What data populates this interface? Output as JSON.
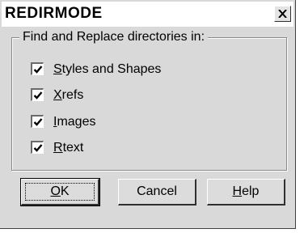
{
  "dialog": {
    "title": "REDIRMODE",
    "close_label": "close"
  },
  "group": {
    "legend": "Find and Replace directories in:"
  },
  "options": [
    {
      "mnemonic": "S",
      "rest": "tyles and Shapes",
      "checked": true
    },
    {
      "mnemonic": "X",
      "rest": "refs",
      "checked": true
    },
    {
      "mnemonic": "I",
      "rest": "mages",
      "checked": true
    },
    {
      "mnemonic": "R",
      "rest": "text",
      "checked": true
    }
  ],
  "buttons": {
    "ok_mnemonic": "O",
    "ok_rest": "K",
    "cancel_label": "Cancel",
    "help_mnemonic": "H",
    "help_rest": "elp"
  }
}
